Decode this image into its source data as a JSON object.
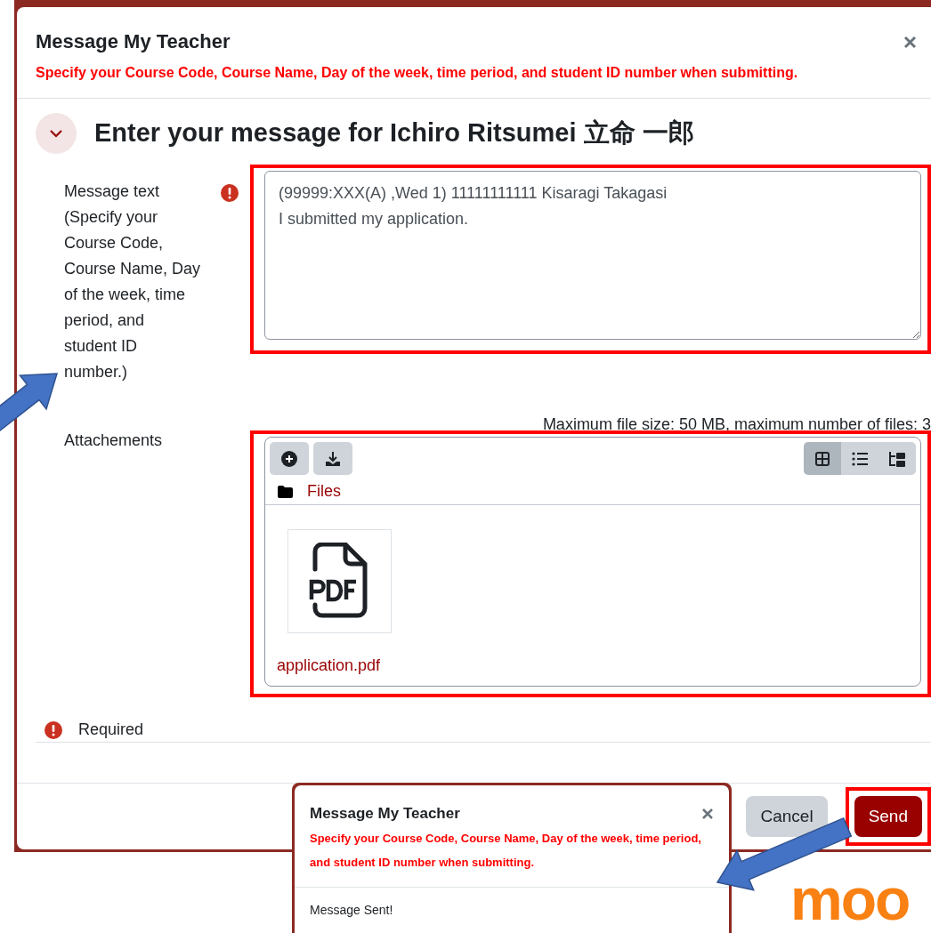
{
  "dialog": {
    "title": "Message My Teacher",
    "instruction": "Specify your Course Code, Course Name, Day of the week, time period, and student ID number when submitting."
  },
  "section": {
    "heading": "Enter your message for Ichiro Ritsumei 立命 一郎",
    "expanded": true
  },
  "message_field": {
    "label": "Message text (Specify your Course Code, Course Name, Day of the week, time period, and student ID number.)",
    "required": true,
    "annotated": true,
    "value": "(99999:XXX(A) ,Wed 1) 11111111111 Kisaragi Takagasi\nI submitted my application."
  },
  "attachments": {
    "label": "Attachements",
    "limits": "Maximum file size: 50 MB, maximum number of files: 3",
    "annotated": true,
    "path": "Files",
    "view_modes": [
      {
        "kind": "icons",
        "selected": true
      },
      {
        "kind": "list",
        "selected": false
      },
      {
        "kind": "tree",
        "selected": false
      }
    ],
    "files": [
      {
        "name": "application.pdf",
        "kind": "pdf"
      }
    ]
  },
  "required_note": "Required",
  "buttons": [
    {
      "label": "Cancel",
      "kind": "secondary",
      "annotated": false
    },
    {
      "label": "Send",
      "kind": "primary",
      "annotated": true
    }
  ],
  "inset": {
    "title": "Message My Teacher",
    "instruction": "Specify your Course Code, Course Name, Day of the week, time period, and student ID number when submitting.",
    "message": "Message Sent!"
  },
  "logo": {
    "text": "moo"
  }
}
